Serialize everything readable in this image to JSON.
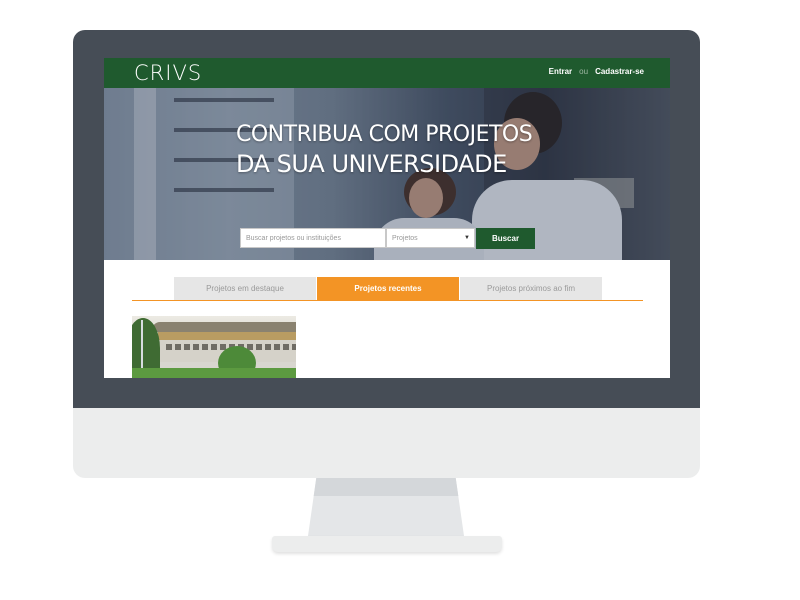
{
  "app": {
    "logo": "CRIVS",
    "header": {
      "login_label": "Entrar",
      "or_label": "ou",
      "signup_label": "Cadastrar-se"
    },
    "hero": {
      "title_line1": "CONTRIBUA COM PROJETOS",
      "title_line2": "DA SUA UNIVERSIDADE"
    },
    "search": {
      "placeholder": "Buscar projetos ou instituições",
      "select_value": "Projetos",
      "button_label": "Buscar"
    },
    "tabs": [
      {
        "label": "Projetos em destaque",
        "active": false
      },
      {
        "label": "Projetos recentes",
        "active": true
      },
      {
        "label": "Projetos próximos ao fim",
        "active": false
      }
    ]
  },
  "colors": {
    "brand_green": "#1f5a2e",
    "accent_orange": "#f39425",
    "bezel": "#464d56"
  }
}
